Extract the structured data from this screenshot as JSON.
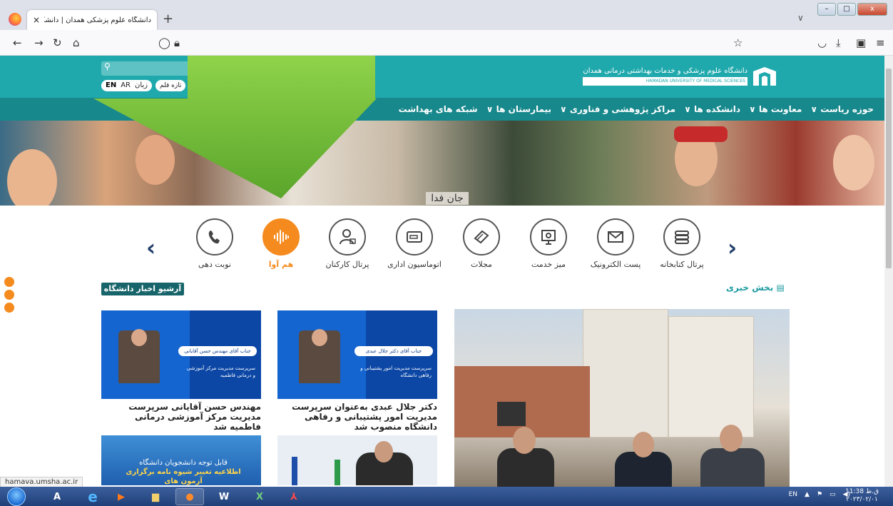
{
  "browser": {
    "tab_title": "دانشگاه علوم پزشکی همدان | دانشگاه ع",
    "tab_close": "×",
    "new_tab": "+",
    "status_url": "hamava.umsha.ac.ir"
  },
  "header": {
    "lang_en": "EN",
    "lang_ar": "AR",
    "lang_label": "زبان",
    "pen_label": "تازه قلم",
    "logo_text": "دانشگاه علوم پزشکی و خدمات بهداشتی درمانی همدان",
    "logo_sub": "HAMADAN UNIVERSITY OF MEDICAL SCIENCES"
  },
  "menu": [
    "حوزه ریاست ∨",
    "معاونت ها ∨",
    "دانشکده ها ∨",
    "مراکز پژوهشی و فناوری ∨",
    "بیمارستان ها ∨",
    "شبکه های بهداشت"
  ],
  "banner": {
    "caption": "جان فدا"
  },
  "services": [
    {
      "label": "پرتال کتابخانه",
      "icon": "library-icon"
    },
    {
      "label": "پست الکترونیک",
      "icon": "email-icon"
    },
    {
      "label": "میز خدمت",
      "icon": "service-desk-icon"
    },
    {
      "label": "مجلات",
      "icon": "journals-icon"
    },
    {
      "label": "اتوماسیون اداری",
      "icon": "automation-icon"
    },
    {
      "label": "پرتال کارکنان",
      "icon": "staff-portal-icon"
    },
    {
      "label": "هم آوا",
      "icon": "audio-wave-icon"
    },
    {
      "label": "نوبت دهی",
      "icon": "phone-icon"
    }
  ],
  "news": {
    "section_title": "بخش خبری",
    "archive_label": "آرشیو اخبار دانشگاه",
    "cards": [
      {
        "title": "دکتر جلال عبدی به‌عنوان سرپرست مدیریت امور پشتیبانی و رفاهی دانشگاه منصوب شد",
        "banner": "جناب آقای دکتر جلال عبدی",
        "desc": "سرپرست مدیریت امور پشتیبانی و رفاهی دانشگاه"
      },
      {
        "title": "مهندس حسن آقایانی سرپرست مدیریت مرکز آموزشی درمانی فاطمیه شد",
        "banner": "جناب آقای مهندس حسن آقایانی",
        "desc": "سرپرست مدیریت مرکز آموزشی و درمانی فاطمیه"
      }
    ],
    "card3_line1": "قابل توجه دانشجویان دانشگاه",
    "card3_line2": "اطلاعیه تغییر شیوه نامه برگزاری آزمون های"
  },
  "taskbar": {
    "lang": "EN",
    "time": "11:38 ق.ظ",
    "date": "۲۰۲۳/۰۲/۰۱"
  }
}
